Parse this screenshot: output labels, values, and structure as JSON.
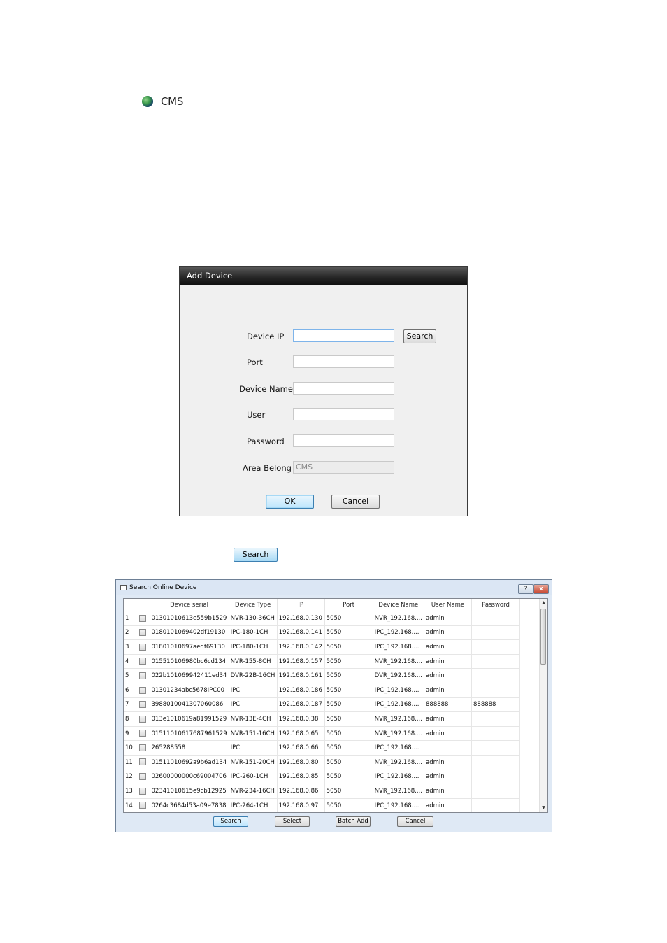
{
  "tree": {
    "item_label": "CMS",
    "icon": "globe-icon"
  },
  "add_device": {
    "title": "Add Device",
    "device_ip_label": "Device IP",
    "port_label": "Port",
    "device_name_label": "Device Name",
    "user_label": "User",
    "password_label": "Password",
    "area_label": "Area Belong",
    "area_value": "CMS",
    "search_label": "Search",
    "ok_label": "OK",
    "cancel_label": "Cancel"
  },
  "standalone_search_label": "Search",
  "search_window": {
    "title": "Search Online Device",
    "help_label": "?",
    "close_label": "x",
    "columns": [
      "Device serial",
      "Device Type",
      "IP",
      "Port",
      "Device Name",
      "User Name",
      "Password"
    ],
    "rows": [
      [
        "1",
        "01301010613e559b1529",
        "NVR-130-36CH",
        "192.168.0.130",
        "5050",
        "NVR_192.168....",
        "admin",
        ""
      ],
      [
        "2",
        "0180101069402df19130",
        "IPC-180-1CH",
        "192.168.0.141",
        "5050",
        "IPC_192.168....",
        "admin",
        ""
      ],
      [
        "3",
        "01801010697aedf69130",
        "IPC-180-1CH",
        "192.168.0.142",
        "5050",
        "IPC_192.168....",
        "admin",
        ""
      ],
      [
        "4",
        "015510106980bc6cd134",
        "NVR-155-8CH",
        "192.168.0.157",
        "5050",
        "NVR_192.168....",
        "admin",
        ""
      ],
      [
        "5",
        "022b101069942411ed34",
        "DVR-22B-16CH",
        "192.168.0.161",
        "5050",
        "DVR_192.168....",
        "admin",
        ""
      ],
      [
        "6",
        "01301234abc5678IPC00",
        "IPC",
        "192.168.0.186",
        "5050",
        "IPC_192.168....",
        "admin",
        ""
      ],
      [
        "7",
        "3988010041307060086",
        "IPC",
        "192.168.0.187",
        "5050",
        "IPC_192.168....",
        "888888",
        "888888"
      ],
      [
        "8",
        "013e1010619a81991529",
        "NVR-13E-4CH",
        "192.168.0.38",
        "5050",
        "NVR_192.168....",
        "admin",
        ""
      ],
      [
        "9",
        "01511010617687961529",
        "NVR-151-16CH",
        "192.168.0.65",
        "5050",
        "NVR_192.168....",
        "admin",
        ""
      ],
      [
        "10",
        "265288558",
        "IPC",
        "192.168.0.66",
        "5050",
        "IPC_192.168....",
        "",
        ""
      ],
      [
        "11",
        "01511010692a9b6ad134",
        "NVR-151-20CH",
        "192.168.0.80",
        "5050",
        "NVR_192.168....",
        "admin",
        ""
      ],
      [
        "12",
        "02600000000c69004706",
        "IPC-260-1CH",
        "192.168.0.85",
        "5050",
        "IPC_192.168....",
        "admin",
        ""
      ],
      [
        "13",
        "02341010615e9cb12925",
        "NVR-234-16CH",
        "192.168.0.86",
        "5050",
        "NVR_192.168....",
        "admin",
        ""
      ],
      [
        "14",
        "0264c3684d53a09e7838",
        "IPC-264-1CH",
        "192.168.0.97",
        "5050",
        "IPC_192.168....",
        "admin",
        ""
      ]
    ],
    "buttons": {
      "search": "Search",
      "select": "Select",
      "batch_add": "Batch Add",
      "cancel": "Cancel"
    }
  }
}
